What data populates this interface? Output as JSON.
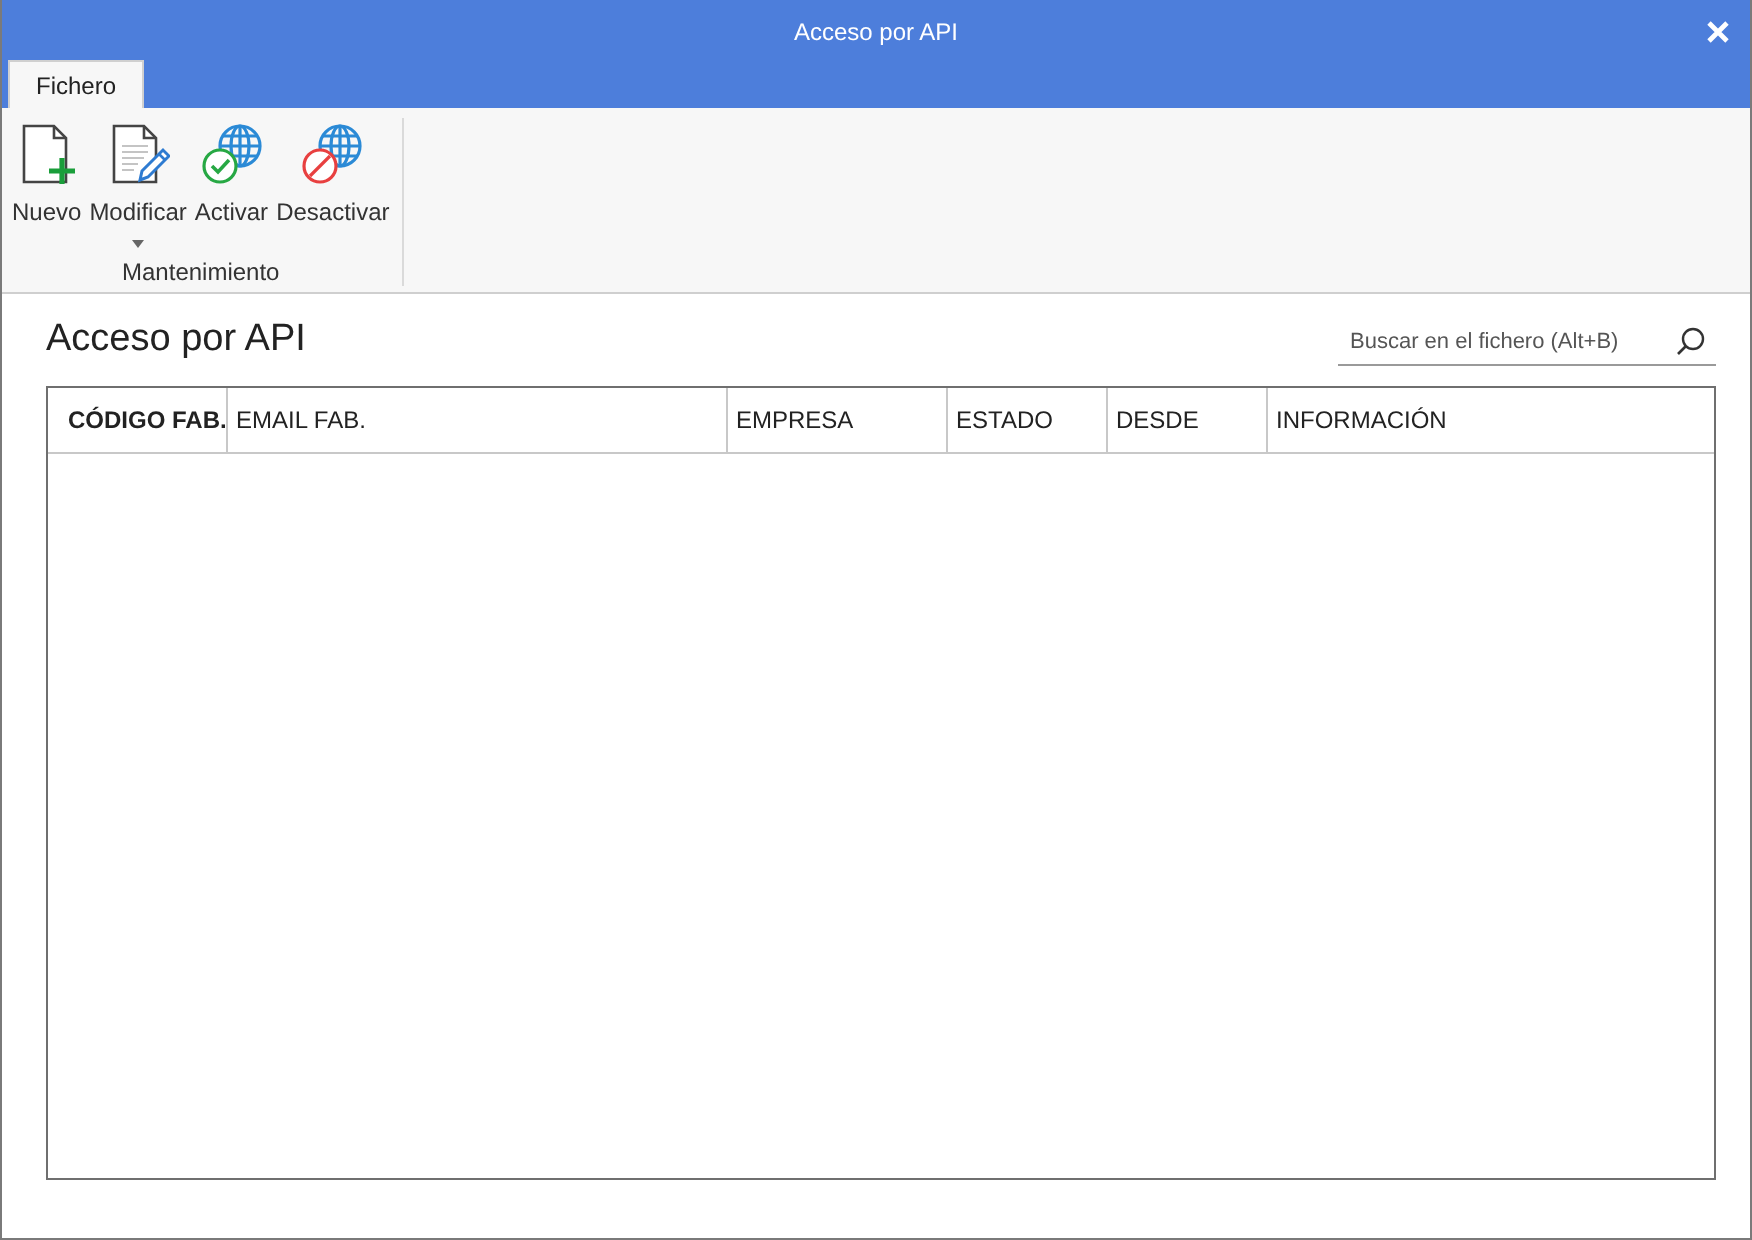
{
  "window": {
    "title": "Acceso por API"
  },
  "tabs": [
    {
      "label": "Fichero",
      "selected": true
    }
  ],
  "ribbon": {
    "groups": [
      {
        "label": "Mantenimiento",
        "buttons": [
          {
            "kind": "new",
            "label": "Nuevo",
            "dropdown": false
          },
          {
            "kind": "edit",
            "label": "Modificar",
            "dropdown": true
          },
          {
            "kind": "activate",
            "label": "Activar",
            "dropdown": false
          },
          {
            "kind": "deactivate",
            "label": "Desactivar",
            "dropdown": false
          }
        ]
      }
    ]
  },
  "page": {
    "heading": "Acceso por API",
    "search": {
      "placeholder": "Buscar en el fichero (Alt+B)"
    },
    "table": {
      "columns": [
        {
          "label": "CÓDIGO FAB.",
          "sorted": true
        },
        {
          "label": "EMAIL FAB.",
          "sorted": false
        },
        {
          "label": "EMPRESA",
          "sorted": false
        },
        {
          "label": "ESTADO",
          "sorted": false
        },
        {
          "label": "DESDE",
          "sorted": false
        },
        {
          "label": "INFORMACIÓN",
          "sorted": false
        }
      ]
    }
  }
}
